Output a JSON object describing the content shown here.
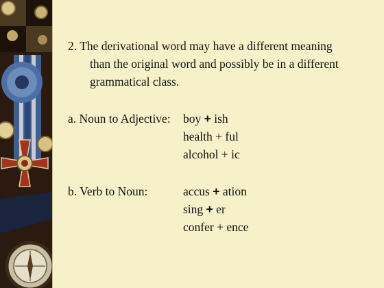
{
  "slide": {
    "point2": {
      "number": "2.",
      "line1": "The derivational word may have a different meaning",
      "line2": "than the original word and possibly be in a different",
      "line3": "grammatical class."
    },
    "section_a": {
      "label": "a.  Noun to Adjective:",
      "examples": [
        {
          "base": "boy",
          "plus": "+",
          "suffix": "ish"
        },
        {
          "base": "health",
          "plus": "+",
          "suffix": "ful"
        },
        {
          "base": "alcohol",
          "plus": "+",
          "suffix": "ic"
        }
      ]
    },
    "section_b": {
      "label": "b.  Verb to Noun:",
      "examples": [
        {
          "base": "accus",
          "plus": "+",
          "suffix": "ation"
        },
        {
          "base": "sing",
          "plus": "+",
          "suffix": "er"
        },
        {
          "base": "confer",
          "plus": "+",
          "suffix": "ence"
        }
      ]
    }
  },
  "colors": {
    "background": "#f7f1c9",
    "text": "#111111",
    "sidebar_dark": "#2a1a10",
    "medal_red": "#a3331e",
    "ribbon_blue": "#3d5f93"
  }
}
